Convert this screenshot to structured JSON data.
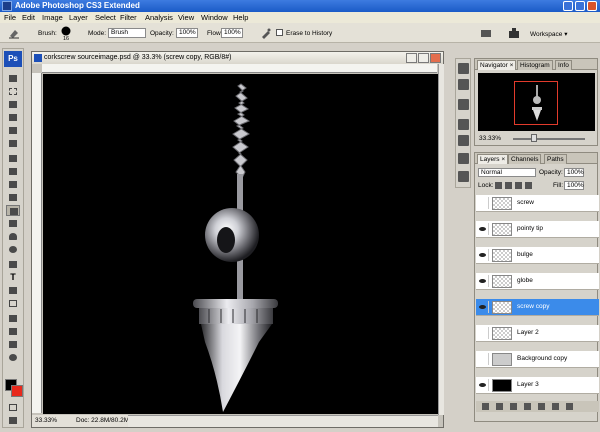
{
  "app": {
    "title": "Adobe Photoshop CS3 Extended"
  },
  "menu": [
    "File",
    "Edit",
    "Image",
    "Layer",
    "Select",
    "Filter",
    "Analysis",
    "View",
    "Window",
    "Help"
  ],
  "options": {
    "brush_label": "Brush:",
    "brush_size": "16",
    "mode_label": "Mode:",
    "mode_value": "Brush",
    "opacity_label": "Opacity:",
    "opacity_value": "100%",
    "flow_label": "Flow:",
    "flow_value": "100%",
    "erase_history": "Erase to History",
    "workspace": "Workspace ▾"
  },
  "toolbox": {
    "logo": "Ps"
  },
  "document": {
    "title": "corkscrew sourceimage.psd @ 33.3% (screw copy, RGB/8#)",
    "zoom": "33.33%",
    "doc_info": "Doc: 22.8M/80.2M"
  },
  "navigator": {
    "tabs": [
      "Navigator ×",
      "Histogram",
      "Info"
    ],
    "zoom": "33.33%"
  },
  "layers_panel": {
    "tabs": [
      "Layers ×",
      "Channels",
      "Paths"
    ],
    "blend_mode": "Normal",
    "opacity_label": "Opacity:",
    "opacity_value": "100%",
    "lock_label": "Lock:",
    "fill_label": "Fill:",
    "fill_value": "100%",
    "layers": [
      {
        "name": "screw",
        "visible": false,
        "selected": false,
        "thumb": "transparent"
      },
      {
        "name": "pointy tip",
        "visible": true,
        "selected": false,
        "thumb": "transparent"
      },
      {
        "name": "bulge",
        "visible": true,
        "selected": false,
        "thumb": "transparent"
      },
      {
        "name": "globe",
        "visible": true,
        "selected": false,
        "thumb": "transparent"
      },
      {
        "name": "screw copy",
        "visible": true,
        "selected": true,
        "thumb": "transparent"
      },
      {
        "name": "Layer 2",
        "visible": false,
        "selected": false,
        "thumb": "transparent"
      },
      {
        "name": "Background copy",
        "visible": false,
        "selected": false,
        "thumb": "object"
      },
      {
        "name": "Layer 3",
        "visible": true,
        "selected": false,
        "thumb": "black"
      }
    ]
  },
  "colors": {
    "foreground": "#000000",
    "background": "#e8291c",
    "selection": "#3b8bea"
  }
}
